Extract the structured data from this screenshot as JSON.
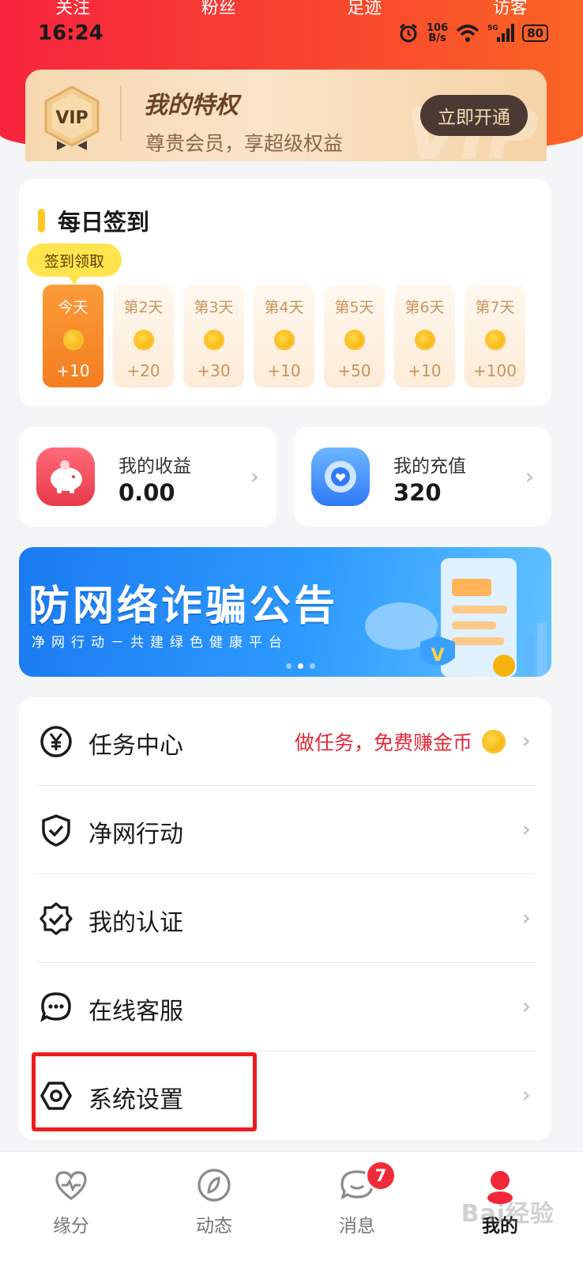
{
  "header": {
    "stats": [
      "关注",
      "粉丝",
      "足迹",
      "访客"
    ],
    "status_time": "16:24",
    "net_speed_value": "106",
    "net_speed_unit": "B/s",
    "battery": "80"
  },
  "vip": {
    "badge": "VIP",
    "title": "我的特权",
    "subtitle": "尊贵会员，享超级权益",
    "button": "立即开通",
    "watermark": "VIP"
  },
  "checkin": {
    "title": "每日签到",
    "tip": "签到领取",
    "days": [
      {
        "label": "今天",
        "amount": "+10"
      },
      {
        "label": "第2天",
        "amount": "+20"
      },
      {
        "label": "第3天",
        "amount": "+30"
      },
      {
        "label": "第4天",
        "amount": "+10"
      },
      {
        "label": "第5天",
        "amount": "+50"
      },
      {
        "label": "第6天",
        "amount": "+10"
      },
      {
        "label": "第7天",
        "amount": "+100"
      }
    ]
  },
  "wallet": {
    "earnings_label": "我的收益",
    "earnings_value": "0.00",
    "recharge_label": "我的充值",
    "recharge_value": "320"
  },
  "banner": {
    "title": "防网络诈骗公告",
    "subtitle": "净网行动－共建绿色健康平台"
  },
  "menu": {
    "items": [
      {
        "label": "任务中心",
        "icon": "yen-icon"
      },
      {
        "label": "净网行动",
        "icon": "shield-icon"
      },
      {
        "label": "我的认证",
        "icon": "verified-icon"
      },
      {
        "label": "在线客服",
        "icon": "chat-icon"
      },
      {
        "label": "系统设置",
        "icon": "settings-icon"
      }
    ],
    "promo": "做任务，免费赚金币"
  },
  "tabbar": {
    "tabs": [
      "缘分",
      "动态",
      "消息",
      "我的"
    ],
    "message_badge": "7",
    "active": "我的"
  },
  "watermark": "Bai经验"
}
